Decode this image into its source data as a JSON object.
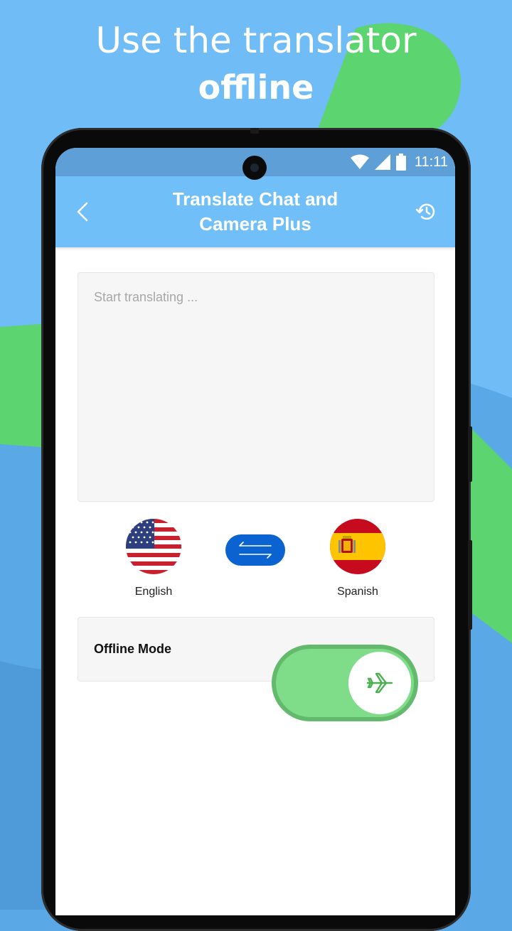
{
  "headline": {
    "line1": "Use the translator",
    "line2": "offline"
  },
  "status_bar": {
    "time": "11:11"
  },
  "app_bar": {
    "title": "Translate Chat and\nCamera Plus"
  },
  "input": {
    "placeholder": "Start translating ..."
  },
  "languages": {
    "source": "English",
    "target": "Spanish"
  },
  "offline_mode": {
    "label": "Offline Mode",
    "enabled": true
  },
  "icons": [
    "chevron-left-icon",
    "history-icon",
    "swap-arrows-icon",
    "airplane-icon",
    "wifi-icon",
    "signal-icon",
    "battery-icon"
  ],
  "colors": {
    "app_bar": "#70bff9",
    "swap_button": "#0a63d1",
    "toggle_on": "#7fdd8a",
    "background_blue": "#5aa8e6",
    "background_green": "#5cd46f"
  }
}
